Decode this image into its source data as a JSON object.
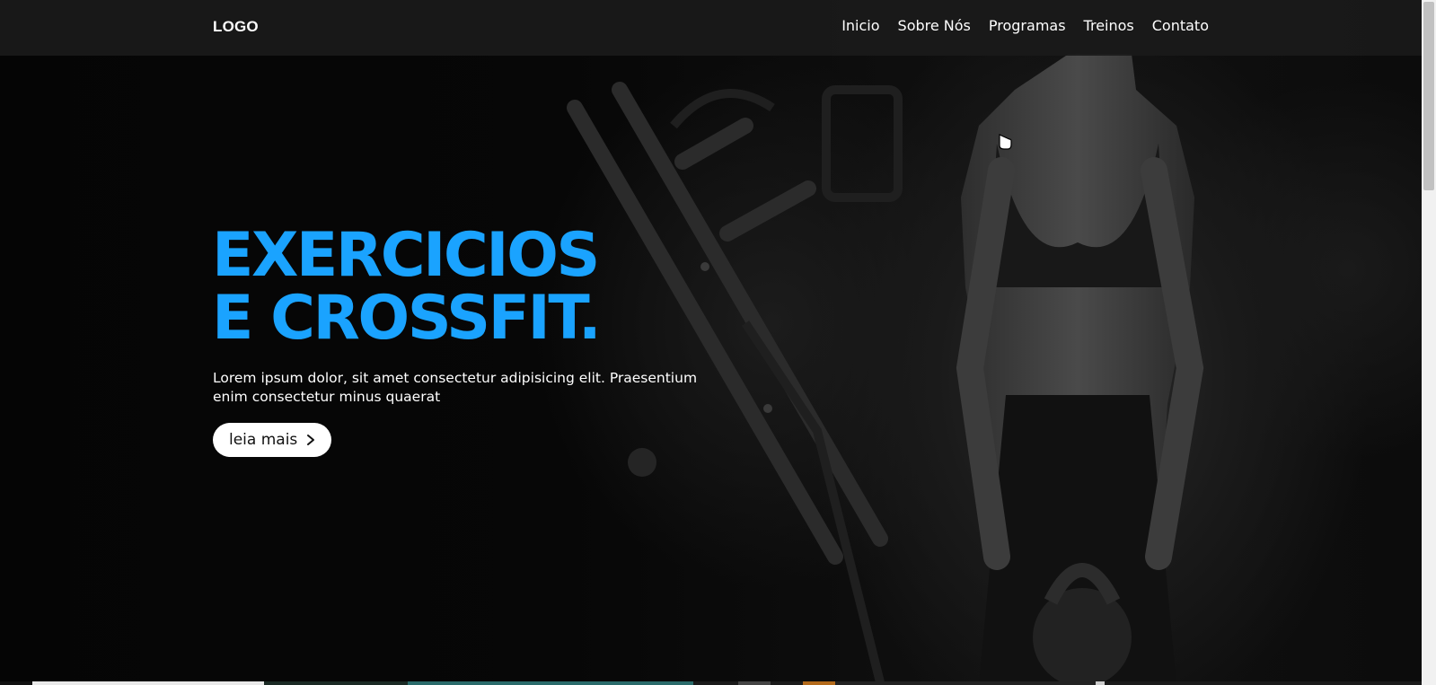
{
  "header": {
    "logo": "LOGO",
    "nav": [
      "Inicio",
      "Sobre Nós",
      "Programas",
      "Treinos",
      "Contato"
    ]
  },
  "hero": {
    "title_line1": "EXERCICIOS",
    "title_line2": "E CROSSFIT.",
    "description": "Lorem ipsum dolor, sit amet consectetur adipisicing elit. Praesentium enim consectetur minus quaerat",
    "cta_label": "leia mais",
    "cta_icon": "chevron-right-icon"
  },
  "colors": {
    "accent": "#1aa3ff",
    "header_bg": "#1a1a1a",
    "button_bg": "#ffffff",
    "button_text": "#111111"
  }
}
